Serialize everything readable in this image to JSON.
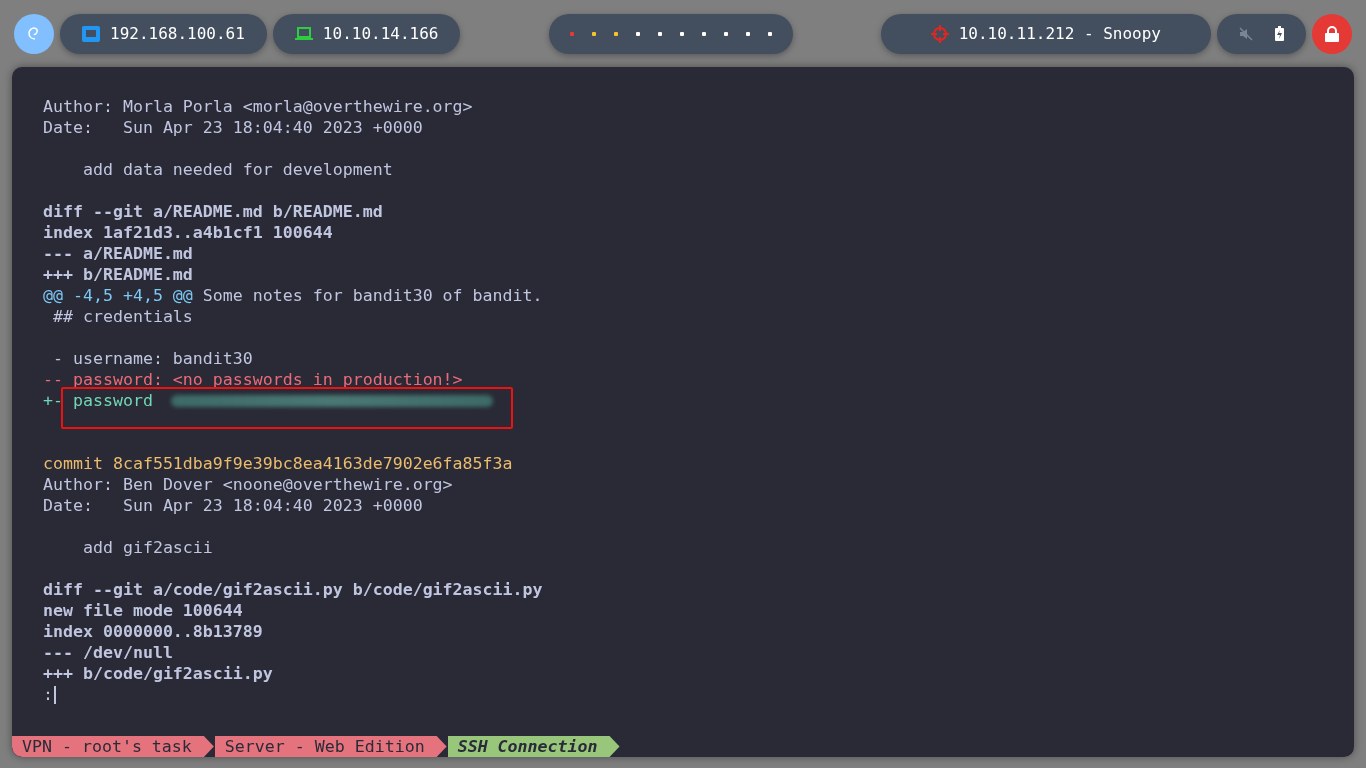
{
  "top_bar": {
    "ip_items": [
      {
        "kind": "ethernet",
        "text": "192.168.100.61"
      },
      {
        "kind": "vpn",
        "text": "10.10.14.166"
      }
    ],
    "workspaces": [
      {
        "color": "#e53935"
      },
      {
        "color": "#fbc02d"
      },
      {
        "color": "#fbc02d"
      },
      {
        "color": "#ffffff"
      },
      {
        "color": "#ffffff"
      },
      {
        "color": "#ffffff"
      },
      {
        "color": "#ffffff"
      },
      {
        "color": "#ffffff"
      },
      {
        "color": "#ffffff"
      },
      {
        "color": "#ffffff"
      }
    ],
    "target": {
      "text": "10.10.11.212 - Snoopy"
    },
    "sound_muted": true
  },
  "terminal": {
    "lines": [
      {
        "kind": "plain",
        "text": "Author: Morla Porla <morla@overthewire.org>"
      },
      {
        "kind": "plain",
        "text": "Date:   Sun Apr 23 18:04:40 2023 +0000"
      },
      {
        "kind": "blank"
      },
      {
        "kind": "plain",
        "text": "    add data needed for development"
      },
      {
        "kind": "blank"
      },
      {
        "kind": "header",
        "text": "diff --git a/README.md b/README.md"
      },
      {
        "kind": "header",
        "text": "index 1af21d3..a4b1cf1 100644"
      },
      {
        "kind": "header",
        "text": "--- a/README.md"
      },
      {
        "kind": "header",
        "text": "+++ b/README.md"
      },
      {
        "kind": "hunk",
        "marker": "@@ -4,5 +4,5 @@",
        "text": " Some notes for bandit30 of bandit."
      },
      {
        "kind": "plain",
        "text": " ## credentials"
      },
      {
        "kind": "blank"
      },
      {
        "kind": "plain",
        "text": " - username: bandit30"
      },
      {
        "kind": "removed",
        "text": "-- password: <no passwords in production!>"
      },
      {
        "kind": "added",
        "text": "+- password",
        "redacted": true,
        "highlighted": true
      },
      {
        "kind": "blank"
      },
      {
        "kind": "blank"
      },
      {
        "kind": "commit",
        "text": "commit 8caf551dba9f9e39bc8ea4163de7902e6fa85f3a"
      },
      {
        "kind": "plain",
        "text": "Author: Ben Dover <noone@overthewire.org>"
      },
      {
        "kind": "plain",
        "text": "Date:   Sun Apr 23 18:04:40 2023 +0000"
      },
      {
        "kind": "blank"
      },
      {
        "kind": "plain",
        "text": "    add gif2ascii"
      },
      {
        "kind": "blank"
      },
      {
        "kind": "header",
        "text": "diff --git a/code/gif2ascii.py b/code/gif2ascii.py"
      },
      {
        "kind": "header",
        "text": "new file mode 100644"
      },
      {
        "kind": "header",
        "text": "index 0000000..8b13789"
      },
      {
        "kind": "header",
        "text": "--- /dev/null"
      },
      {
        "kind": "header",
        "text": "+++ b/code/gif2ascii.py"
      },
      {
        "kind": "prompt",
        "text": ":"
      }
    ]
  },
  "status_bar": {
    "segments": [
      {
        "text": "VPN - root's task",
        "selected": false
      },
      {
        "text": "Server - Web Edition",
        "selected": false
      },
      {
        "text": "SSH Connection",
        "selected": true
      }
    ]
  }
}
